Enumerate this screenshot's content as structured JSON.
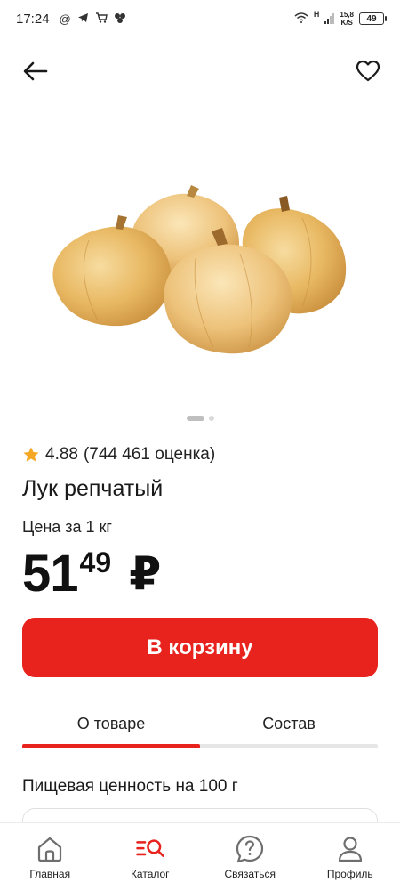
{
  "status_bar": {
    "time": "17:24",
    "net_type": "H",
    "net_speed_value": "15,8",
    "net_speed_unit": "K/S",
    "battery": "49"
  },
  "product": {
    "rating": "4.88",
    "rating_count": "(744 461 оценка)",
    "title": "Лук репчатый",
    "unit_label": "Цена за 1 кг",
    "price_rub": "51",
    "price_kop": "49",
    "currency": "₽",
    "image_icon": "onion-image",
    "image_count": 2,
    "image_active": 1
  },
  "actions": {
    "add_to_cart": "В корзину"
  },
  "tabs": [
    {
      "label": "О товаре",
      "active": true
    },
    {
      "label": "Состав",
      "active": false
    }
  ],
  "nutrition": {
    "title": "Пищевая ценность на 100 г"
  },
  "bottom_nav": [
    {
      "label": "Главная",
      "icon": "home-icon"
    },
    {
      "label": "Каталог",
      "icon": "catalog-search-icon",
      "active": true
    },
    {
      "label": "Связаться",
      "icon": "help-chat-icon"
    },
    {
      "label": "Профиль",
      "icon": "profile-icon"
    }
  ],
  "colors": {
    "accent": "#e8231e",
    "star": "#f5a623",
    "onion": "#e8b862"
  }
}
